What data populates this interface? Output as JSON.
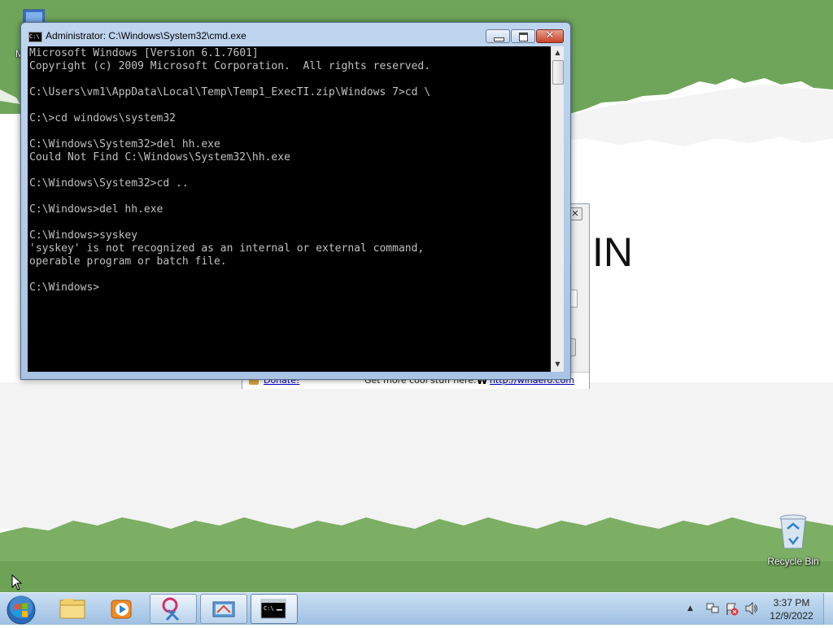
{
  "desktop": {
    "icons": [
      {
        "label": "My C",
        "icon": "computer-icon"
      },
      {
        "label": "Recycle Bin",
        "icon": "recycle-bin-icon"
      }
    ]
  },
  "background_window": {
    "big_text": "IN",
    "close_glyph": "✕",
    "footer": {
      "donate_label": "Donate!",
      "get_more_label": "Get more cool stuff here:",
      "link_text": "http://winaero.com"
    }
  },
  "cmd_window": {
    "title": "Administrator: C:\\Windows\\System32\\cmd.exe",
    "icon_text": "C:\\",
    "buttons": {
      "minimize": "minimize",
      "maximize": "maximize",
      "close": "✕"
    },
    "console_lines": [
      "Microsoft Windows [Version 6.1.7601]",
      "Copyright (c) 2009 Microsoft Corporation.  All rights reserved.",
      "",
      "C:\\Users\\vm1\\AppData\\Local\\Temp\\Temp1_ExecTI.zip\\Windows 7>cd \\",
      "",
      "C:\\>cd windows\\system32",
      "",
      "C:\\Windows\\System32>del hh.exe",
      "Could Not Find C:\\Windows\\System32\\hh.exe",
      "",
      "C:\\Windows\\System32>cd ..",
      "",
      "C:\\Windows>del hh.exe",
      "",
      "C:\\Windows>syskey",
      "'syskey' is not recognized as an internal or external command,",
      "operable program or batch file.",
      "",
      "C:\\Windows>"
    ],
    "scroll_up": "▲",
    "scroll_down": "▼"
  },
  "taskbar": {
    "items": [
      {
        "name": "explorer",
        "icon": "folder-icon"
      },
      {
        "name": "media-player",
        "icon": "media-player-icon"
      },
      {
        "name": "snipping-tool",
        "icon": "snipping-tool-icon"
      },
      {
        "name": "control-panel",
        "icon": "control-panel-icon"
      },
      {
        "name": "cmd",
        "icon": "cmd-icon"
      }
    ],
    "tray": {
      "show_hidden": "▲"
    },
    "clock": {
      "time": "3:37 PM",
      "date": "12/9/2022"
    }
  }
}
